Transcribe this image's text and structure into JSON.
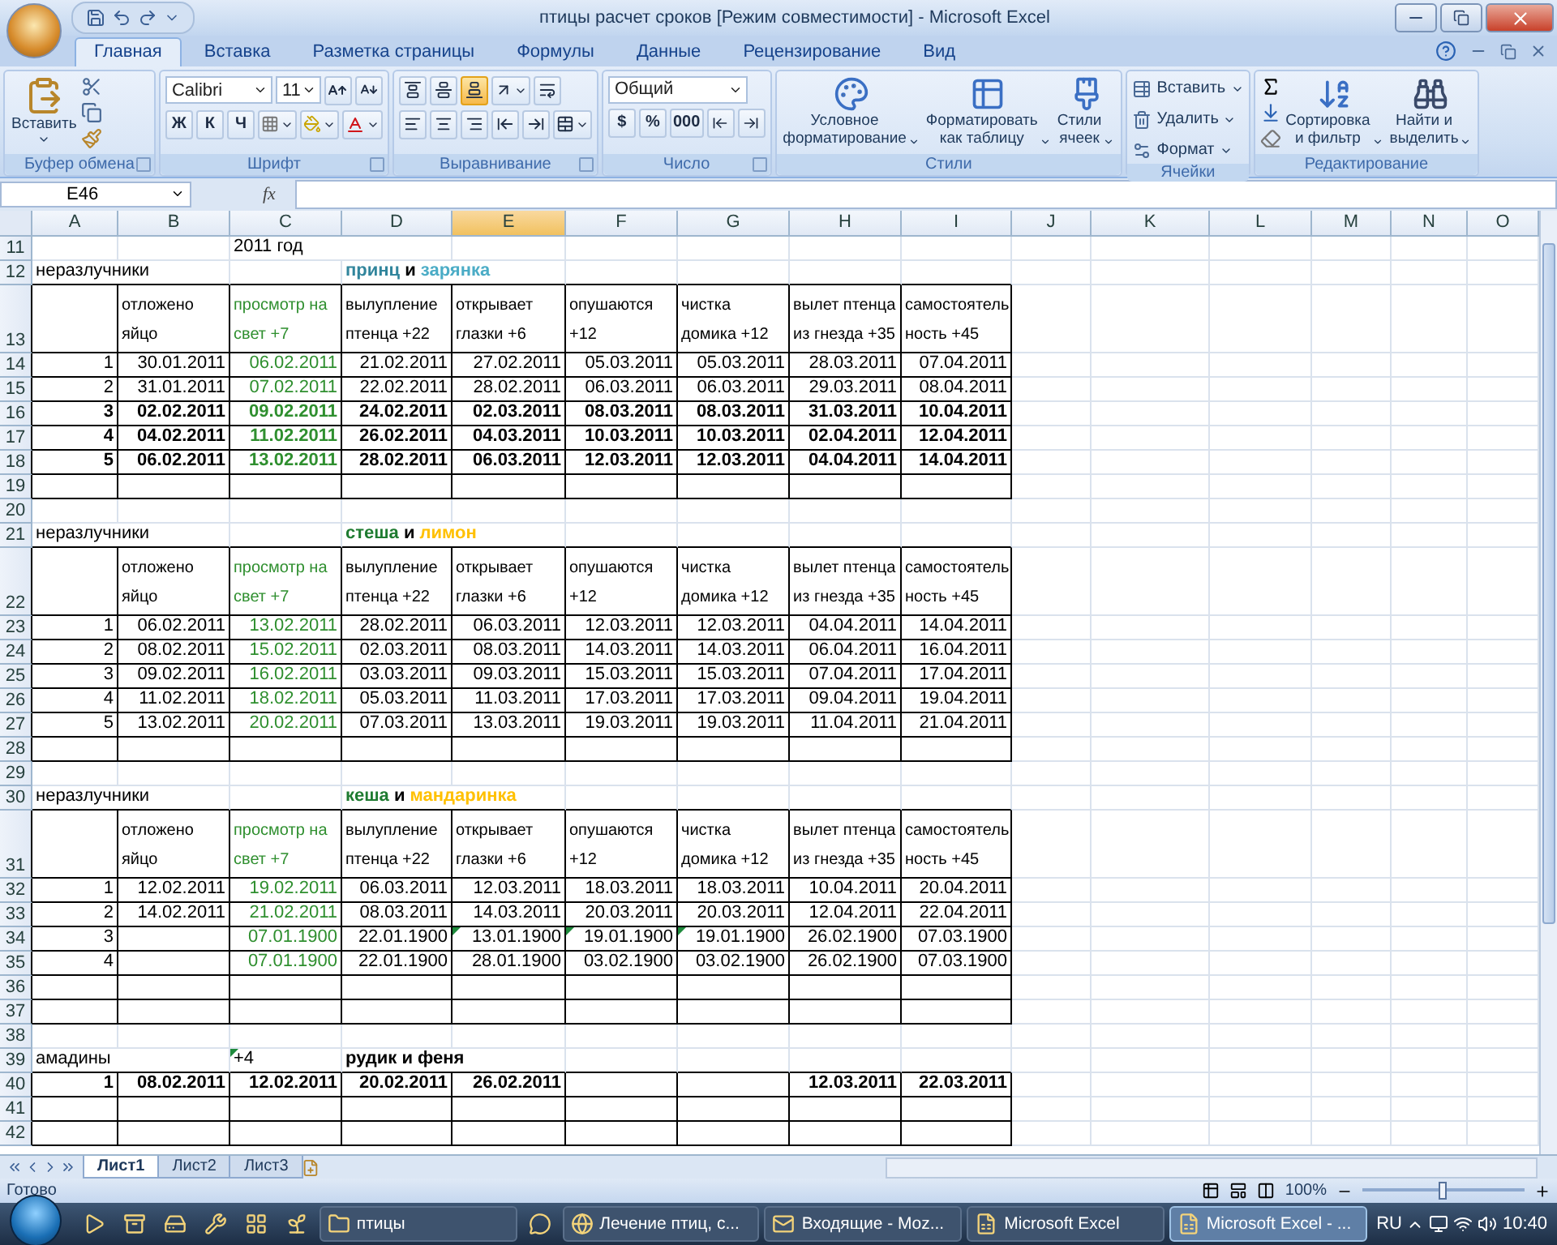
{
  "window": {
    "title": "птицы расчет сроков  [Режим совместимости] - Microsoft Excel"
  },
  "tabs": [
    {
      "label": "Главная",
      "selected": true
    },
    {
      "label": "Вставка",
      "selected": false
    },
    {
      "label": "Разметка страницы",
      "selected": false
    },
    {
      "label": "Формулы",
      "selected": false
    },
    {
      "label": "Данные",
      "selected": false
    },
    {
      "label": "Рецензирование",
      "selected": false
    },
    {
      "label": "Вид",
      "selected": false
    }
  ],
  "ribbon": {
    "clipboard": {
      "label": "Буфер обмена",
      "paste": "Вставить"
    },
    "font": {
      "label": "Шрифт",
      "name": "Calibri",
      "size": "11",
      "styles": [
        "Ж",
        "К",
        "Ч"
      ]
    },
    "alignment": {
      "label": "Выравнивание",
      "vertical": [
        {
          "selected": false
        },
        {
          "selected": false
        },
        {
          "selected": true
        }
      ]
    },
    "number": {
      "label": "Число",
      "format": "Общий",
      "buttons": [
        "$",
        "%",
        "000"
      ]
    },
    "styles": {
      "label": "Стили",
      "items": [
        {
          "kind": "conditional",
          "lines": [
            "Условное",
            "форматирование"
          ]
        },
        {
          "kind": "table",
          "lines": [
            "Форматировать",
            "как таблицу"
          ]
        },
        {
          "kind": "cell",
          "lines": [
            "Стили",
            "ячеек"
          ]
        }
      ]
    },
    "cells": {
      "label": "Ячейки",
      "items": [
        {
          "kind": "insert",
          "label": "Вставить"
        },
        {
          "kind": "delete",
          "label": "Удалить"
        },
        {
          "kind": "format",
          "label": "Формат"
        }
      ]
    },
    "editing": {
      "label": "Редактирование",
      "items": [
        {
          "kind": "sort",
          "lines": [
            "Сортировка",
            "и фильтр"
          ]
        },
        {
          "kind": "find",
          "lines": [
            "Найти и",
            "выделить"
          ]
        }
      ]
    }
  },
  "formula_bar": {
    "name_box": "E46",
    "fx": "fx"
  },
  "columns": [
    {
      "label": "A",
      "selected": false
    },
    {
      "label": "B",
      "selected": false
    },
    {
      "label": "C",
      "selected": false
    },
    {
      "label": "D",
      "selected": false
    },
    {
      "label": "E",
      "selected": true
    },
    {
      "label": "F",
      "selected": false
    },
    {
      "label": "G",
      "selected": false
    },
    {
      "label": "H",
      "selected": false
    },
    {
      "label": "I",
      "selected": false
    },
    {
      "label": "J",
      "selected": false
    },
    {
      "label": "K",
      "selected": false
    },
    {
      "label": "L",
      "selected": false
    },
    {
      "label": "M",
      "selected": false
    },
    {
      "label": "N",
      "selected": false
    },
    {
      "label": "O",
      "selected": false
    }
  ],
  "rows": [
    {
      "number": "11",
      "boxed": false,
      "cells": [
        null,
        null,
        {
          "text": "2011 год"
        }
      ]
    },
    {
      "number": "12",
      "boxed": false,
      "cells": [
        "неразлучники",
        null,
        null,
        {
          "bold": true,
          "runs": [
            {
              "text": "принц",
              "color": "#31859c"
            },
            {
              "text": " и "
            },
            {
              "text": "зарянка",
              "color": "#4bacc6"
            }
          ]
        }
      ]
    },
    {
      "number": "13",
      "boxed": true,
      "tall": true,
      "cells": [
        null,
        {
          "lines": [
            "отложено",
            "яйцо"
          ]
        },
        {
          "lines": [
            "просмотр на",
            "свет +7"
          ],
          "color": "#2f8f2f"
        },
        {
          "lines": [
            "вылупление",
            "птенца +22"
          ]
        },
        {
          "lines": [
            "открывает",
            "глазки +6"
          ]
        },
        {
          "lines": [
            "опушаются",
            "+12"
          ]
        },
        {
          "lines": [
            "чистка",
            "домика +12"
          ]
        },
        {
          "lines": [
            "вылет птенца",
            "из гнезда +35"
          ]
        },
        {
          "lines": [
            "самостоятель",
            "ность +45"
          ]
        }
      ]
    },
    {
      "number": "14",
      "boxed": true,
      "numeric": true,
      "cells": [
        "1",
        "30.01.2011",
        {
          "text": "06.02.2011",
          "color": "#2f8f2f"
        },
        "21.02.2011",
        "27.02.2011",
        "05.03.2011",
        "05.03.2011",
        "28.03.2011",
        "07.04.2011"
      ]
    },
    {
      "number": "15",
      "boxed": true,
      "numeric": true,
      "cells": [
        "2",
        "31.01.2011",
        {
          "text": "07.02.2011",
          "color": "#2f8f2f"
        },
        "22.02.2011",
        "28.02.2011",
        "06.03.2011",
        "06.03.2011",
        "29.03.2011",
        "08.04.2011"
      ]
    },
    {
      "number": "16",
      "boxed": true,
      "numeric": true,
      "bold": true,
      "cells": [
        "3",
        "02.02.2011",
        {
          "text": "09.02.2011",
          "color": "#2f8f2f"
        },
        "24.02.2011",
        "02.03.2011",
        "08.03.2011",
        "08.03.2011",
        "31.03.2011",
        "10.04.2011"
      ]
    },
    {
      "number": "17",
      "boxed": true,
      "numeric": true,
      "bold": true,
      "cells": [
        "4",
        "04.02.2011",
        {
          "text": "11.02.2011",
          "color": "#2f8f2f"
        },
        "26.02.2011",
        "04.03.2011",
        "10.03.2011",
        "10.03.2011",
        "02.04.2011",
        "12.04.2011"
      ]
    },
    {
      "number": "18",
      "boxed": true,
      "numeric": true,
      "bold": true,
      "cells": [
        "5",
        "06.02.2011",
        {
          "text": "13.02.2011",
          "color": "#2f8f2f"
        },
        "28.02.2011",
        "06.03.2011",
        "12.03.2011",
        "12.03.2011",
        "04.04.2011",
        "14.04.2011"
      ]
    },
    {
      "number": "19",
      "boxed": true,
      "cells": []
    },
    {
      "number": "20",
      "boxed": false,
      "cells": []
    },
    {
      "number": "21",
      "boxed": false,
      "cells": [
        "неразлучники",
        null,
        null,
        {
          "bold": true,
          "runs": [
            {
              "text": "стеша",
              "color": "#1e7b30"
            },
            {
              "text": " и "
            },
            {
              "text": "лимон",
              "color": "#ffc000"
            }
          ]
        }
      ]
    },
    {
      "number": "22",
      "boxed": true,
      "tall": true,
      "cells": [
        null,
        {
          "lines": [
            "отложено",
            "яйцо"
          ]
        },
        {
          "lines": [
            "просмотр на",
            "свет +7"
          ],
          "color": "#2f8f2f"
        },
        {
          "lines": [
            "вылупление",
            "птенца +22"
          ]
        },
        {
          "lines": [
            "открывает",
            "глазки +6"
          ]
        },
        {
          "lines": [
            "опушаются",
            "+12"
          ]
        },
        {
          "lines": [
            "чистка",
            "домика +12"
          ]
        },
        {
          "lines": [
            "вылет птенца",
            "из гнезда +35"
          ]
        },
        {
          "lines": [
            "самостоятель",
            "ность +45"
          ]
        }
      ]
    },
    {
      "number": "23",
      "boxed": true,
      "numeric": true,
      "cells": [
        "1",
        "06.02.2011",
        {
          "text": "13.02.2011",
          "color": "#2f8f2f"
        },
        "28.02.2011",
        "06.03.2011",
        "12.03.2011",
        "12.03.2011",
        "04.04.2011",
        "14.04.2011"
      ]
    },
    {
      "number": "24",
      "boxed": true,
      "numeric": true,
      "cells": [
        "2",
        "08.02.2011",
        {
          "text": "15.02.2011",
          "color": "#2f8f2f"
        },
        "02.03.2011",
        "08.03.2011",
        "14.03.2011",
        "14.03.2011",
        "06.04.2011",
        "16.04.2011"
      ]
    },
    {
      "number": "25",
      "boxed": true,
      "numeric": true,
      "cells": [
        "3",
        "09.02.2011",
        {
          "text": "16.02.2011",
          "color": "#2f8f2f"
        },
        "03.03.2011",
        "09.03.2011",
        "15.03.2011",
        "15.03.2011",
        "07.04.2011",
        "17.04.2011"
      ]
    },
    {
      "number": "26",
      "boxed": true,
      "numeric": true,
      "cells": [
        "4",
        "11.02.2011",
        {
          "text": "18.02.2011",
          "color": "#2f8f2f"
        },
        "05.03.2011",
        "11.03.2011",
        "17.03.2011",
        "17.03.2011",
        "09.04.2011",
        "19.04.2011"
      ]
    },
    {
      "number": "27",
      "boxed": true,
      "numeric": true,
      "cells": [
        "5",
        "13.02.2011",
        {
          "text": "20.02.2011",
          "color": "#2f8f2f"
        },
        "07.03.2011",
        "13.03.2011",
        "19.03.2011",
        "19.03.2011",
        "11.04.2011",
        "21.04.2011"
      ]
    },
    {
      "number": "28",
      "boxed": true,
      "cells": []
    },
    {
      "number": "29",
      "boxed": false,
      "cells": []
    },
    {
      "number": "30",
      "boxed": false,
      "cells": [
        "неразлучники",
        null,
        null,
        {
          "bold": true,
          "runs": [
            {
              "text": "кеша",
              "color": "#1e7b30"
            },
            {
              "text": " и "
            },
            {
              "text": "мандаринка",
              "color": "#ffc000"
            }
          ]
        }
      ]
    },
    {
      "number": "31",
      "boxed": true,
      "tall": true,
      "cells": [
        null,
        {
          "lines": [
            "отложено",
            "яйцо"
          ]
        },
        {
          "lines": [
            "просмотр на",
            "свет +7"
          ],
          "color": "#2f8f2f"
        },
        {
          "lines": [
            "вылупление",
            "птенца +22"
          ]
        },
        {
          "lines": [
            "открывает",
            "глазки +6"
          ]
        },
        {
          "lines": [
            "опушаются",
            "+12"
          ]
        },
        {
          "lines": [
            "чистка",
            "домика +12"
          ]
        },
        {
          "lines": [
            "вылет птенца",
            "из гнезда +35"
          ]
        },
        {
          "lines": [
            "самостоятель",
            "ность +45"
          ]
        }
      ]
    },
    {
      "number": "32",
      "boxed": true,
      "numeric": true,
      "cells": [
        "1",
        "12.02.2011",
        {
          "text": "19.02.2011",
          "color": "#2f8f2f"
        },
        "06.03.2011",
        "12.03.2011",
        "18.03.2011",
        "18.03.2011",
        "10.04.2011",
        "20.04.2011"
      ]
    },
    {
      "number": "33",
      "boxed": true,
      "numeric": true,
      "cells": [
        "2",
        "14.02.2011",
        {
          "text": "21.02.2011",
          "color": "#2f8f2f"
        },
        "08.03.2011",
        "14.03.2011",
        "20.03.2011",
        "20.03.2011",
        "12.04.2011",
        "22.04.2011"
      ]
    },
    {
      "number": "34",
      "boxed": true,
      "numeric": true,
      "cells": [
        "3",
        null,
        {
          "text": "07.01.1900",
          "color": "#2f8f2f"
        },
        "22.01.1900",
        {
          "text": "13.01.1900",
          "flag": true
        },
        {
          "text": "19.01.1900",
          "flag": true
        },
        {
          "text": "19.01.1900",
          "flag": true
        },
        "26.02.1900",
        "07.03.1900"
      ]
    },
    {
      "number": "35",
      "boxed": true,
      "numeric": true,
      "cells": [
        "4",
        null,
        {
          "text": "07.01.1900",
          "color": "#2f8f2f"
        },
        "22.01.1900",
        "28.01.1900",
        "03.02.1900",
        "03.02.1900",
        "26.02.1900",
        "07.03.1900"
      ]
    },
    {
      "number": "36",
      "boxed": true,
      "cells": []
    },
    {
      "number": "37",
      "boxed": true,
      "cells": []
    },
    {
      "number": "38",
      "boxed": false,
      "cells": []
    },
    {
      "number": "39",
      "boxed": false,
      "cells": [
        "амадины",
        null,
        {
          "text": "+4",
          "flag": true
        },
        {
          "text": "рудик и феня",
          "bold": true
        }
      ]
    },
    {
      "number": "40",
      "boxed": true,
      "numeric": true,
      "bold": true,
      "cells": [
        "1",
        "08.02.2011",
        "12.02.2011",
        "20.02.2011",
        "26.02.2011",
        null,
        null,
        "12.03.2011",
        "22.03.2011"
      ]
    },
    {
      "number": "41",
      "boxed": true,
      "cells": []
    },
    {
      "number": "42",
      "boxed": true,
      "cells": []
    }
  ],
  "sheets": [
    {
      "label": "Лист1",
      "selected": true
    },
    {
      "label": "Лист2",
      "selected": false
    },
    {
      "label": "Лист3",
      "selected": false
    }
  ],
  "status_bar": {
    "text": "Готово",
    "zoom": "100%",
    "zoom_level": {
      "level": 0.5
    }
  },
  "taskbar": {
    "items": [
      {
        "kind": "media"
      },
      {
        "kind": "archive"
      },
      {
        "kind": "disk"
      },
      {
        "kind": "tool"
      },
      {
        "kind": "grid"
      },
      {
        "kind": "plant"
      },
      {
        "kind": "folder",
        "label": "птицы",
        "selected": false
      },
      {
        "kind": "chat"
      },
      {
        "kind": "browser",
        "label": "Лечение птиц, с...",
        "selected": false
      },
      {
        "kind": "mail",
        "label": "Входящие - Moz...",
        "selected": false
      },
      {
        "kind": "excel",
        "label": "Microsoft Excel",
        "selected": false
      },
      {
        "kind": "excel",
        "label": "Microsoft Excel - ...",
        "selected": true
      }
    ],
    "language": "RU",
    "clock": "10:40"
  }
}
